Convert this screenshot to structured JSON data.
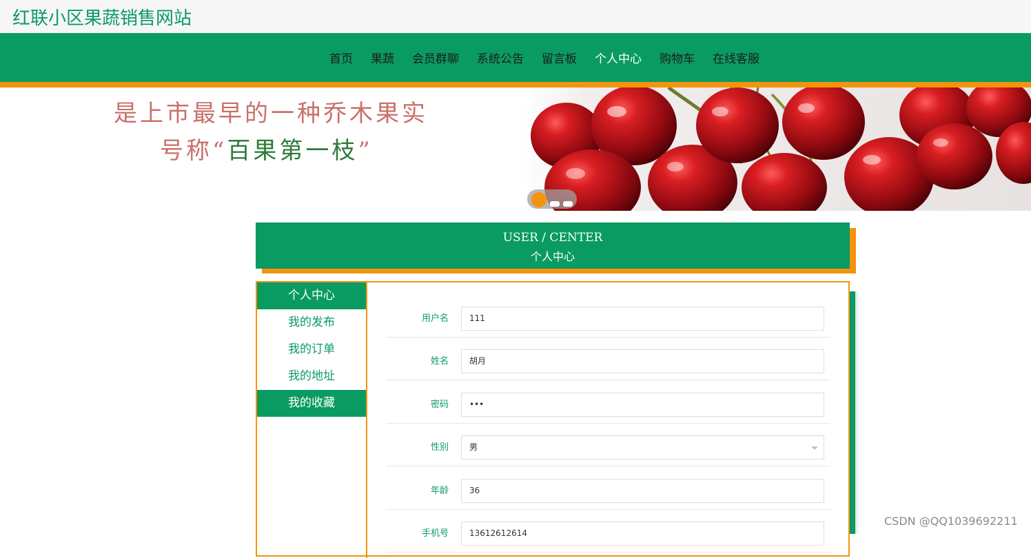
{
  "site": {
    "title": "红联小区果蔬销售网站"
  },
  "nav": {
    "items": [
      {
        "label": "首页"
      },
      {
        "label": "果蔬"
      },
      {
        "label": "会员群聊"
      },
      {
        "label": "系统公告"
      },
      {
        "label": "留言板"
      },
      {
        "label": "个人中心",
        "active": true
      },
      {
        "label": "购物车"
      },
      {
        "label": "在线客服"
      }
    ]
  },
  "banner": {
    "line1": "是上市最早的一种乔木果实",
    "line2_prefix": "号称“",
    "line2_strong": "百果第一枝",
    "line2_suffix": "”",
    "slide_count": 3,
    "active_slide": 1
  },
  "user_center": {
    "en": "USER / CENTER",
    "cn": "个人中心"
  },
  "sidebar": {
    "items": [
      {
        "label": "个人中心",
        "active": true
      },
      {
        "label": "我的发布"
      },
      {
        "label": "我的订单"
      },
      {
        "label": "我的地址"
      },
      {
        "label": "我的收藏",
        "active": true
      }
    ]
  },
  "form": {
    "fields": [
      {
        "label": "用户名",
        "value": "111"
      },
      {
        "label": "姓名",
        "value": "胡月"
      },
      {
        "label": "密码",
        "value": "•••"
      },
      {
        "label": "性别",
        "value": "男"
      },
      {
        "label": "年龄",
        "value": "36"
      },
      {
        "label": "手机号",
        "value": "13612612614"
      }
    ]
  },
  "watermark": "CSDN @QQ1039692211",
  "colors": {
    "brand_green": "#0a9b63",
    "accent_orange": "#f5930d",
    "cherry_red": "#b0101a"
  }
}
